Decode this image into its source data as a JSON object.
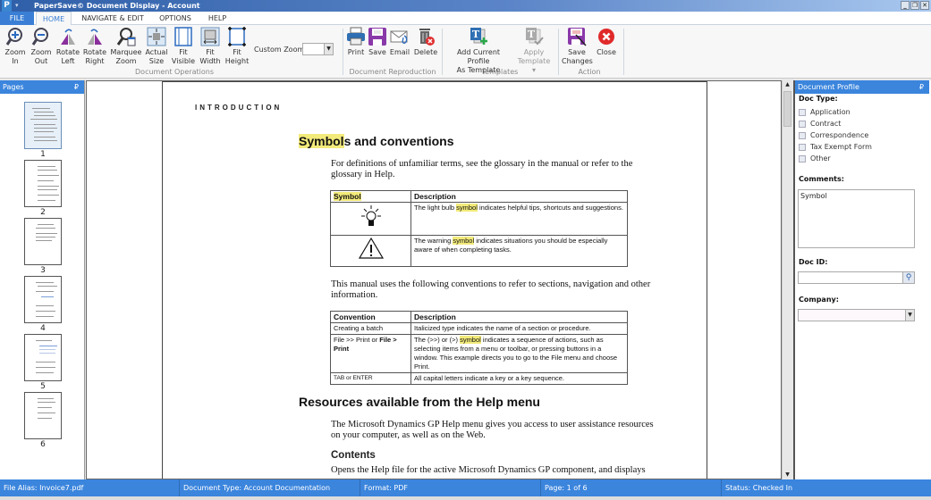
{
  "window": {
    "title": "PaperSave© Document Display - Account",
    "logo": "P",
    "controls": [
      "minimize",
      "restore",
      "close"
    ]
  },
  "tabs": [
    {
      "label": "FILE"
    },
    {
      "label": "HOME",
      "active": true
    },
    {
      "label": "NAVIGATE & EDIT"
    },
    {
      "label": "OPTIONS"
    },
    {
      "label": "HELP"
    }
  ],
  "ribbon": {
    "groups": {
      "document_operations": "Document Operations",
      "document_reproduction": "Document Reproduction",
      "templates": "Templates",
      "action": "Action"
    },
    "buttons": {
      "zoom_in": [
        "Zoom",
        "In"
      ],
      "zoom_out": [
        "Zoom",
        "Out"
      ],
      "rotate_left": [
        "Rotate",
        "Left"
      ],
      "rotate_right": [
        "Rotate",
        "Right"
      ],
      "marquee_zoom": [
        "Marquee",
        "Zoom"
      ],
      "actual_size": [
        "Actual",
        "Size"
      ],
      "fit_visible": [
        "Fit",
        "Visible"
      ],
      "fit_width": [
        "Fit",
        "Width"
      ],
      "fit_height": [
        "Fit",
        "Height"
      ],
      "print": [
        "Print"
      ],
      "save": [
        "Save"
      ],
      "email": [
        "Email"
      ],
      "delete": [
        "Delete"
      ],
      "add_template": [
        "Add Current Profile",
        "As Template"
      ],
      "apply_template": [
        "Apply",
        "Template ▾"
      ],
      "save_changes": [
        "Save",
        "Changes"
      ],
      "close": [
        "Close"
      ]
    },
    "custom_zoom_label": "Custom Zoom:",
    "custom_zoom_value": ""
  },
  "pages_panel": {
    "title": "Pages",
    "pages": [
      "1",
      "2",
      "3",
      "4",
      "5",
      "6"
    ],
    "selected": "1"
  },
  "document": {
    "section": "INTRODUCTION",
    "heading1": {
      "highlight": "Symbol",
      "rest": "s and conventions"
    },
    "para1": "For definitions of unfamiliar terms, see the glossary in the manual or refer to the glossary in Help.",
    "symbol_table": {
      "headers": [
        "Symbol",
        "Description"
      ],
      "rows": [
        {
          "icon": "lightbulb",
          "pre": "The light bulb ",
          "hl": "symbol",
          "post": " indicates helpful tips, shortcuts and suggestions."
        },
        {
          "icon": "warning",
          "pre": "The warning ",
          "hl": "symbol",
          "post": " indicates situations you should be especially aware of when completing tasks."
        }
      ]
    },
    "para2": "This manual uses the following conventions to refer to sections, navigation and other information.",
    "convention_table": {
      "headers": [
        "Convention",
        "Description"
      ],
      "rows": [
        {
          "conv": "Creating a batch",
          "desc": "Italicized type indicates the name of a section or procedure."
        },
        {
          "conv_pre": "File >> Print or ",
          "conv_bold": "File > Print",
          "desc_pre": "The (>>) or (>) ",
          "desc_hl": "symbol",
          "desc_post": " indicates a sequence of actions, such as selecting items from a menu or toolbar, or pressing buttons in a window. This example directs you to go to the File menu and choose Print."
        },
        {
          "conv": "TAB or ENTER",
          "desc": "All capital letters indicate a key or a key sequence."
        }
      ]
    },
    "heading2": "Resources available from the Help menu",
    "para3": "The Microsoft Dynamics GP Help menu gives you access to user assistance resources on your computer, as well as on the Web.",
    "heading3": "Contents",
    "para4": "Opens the Help file for the active Microsoft Dynamics GP component, and displays"
  },
  "profile": {
    "title": "Document Profile",
    "doc_type_label": "Doc Type:",
    "doc_types": [
      "Application",
      "Contract",
      "Correspondence",
      "Tax Exempt Form",
      "Other"
    ],
    "comments_label": "Comments:",
    "comments_value": "Symbol",
    "doc_id_label": "Doc ID:",
    "doc_id_value": "",
    "company_label": "Company:",
    "company_value": ""
  },
  "statusbar": {
    "file_alias": "File Alias: Invoice7.pdf",
    "document_type": "Document Type: Account Documentation",
    "format": "Format: PDF",
    "page": "Page: 1 of 6",
    "status": "Status: Checked In"
  }
}
